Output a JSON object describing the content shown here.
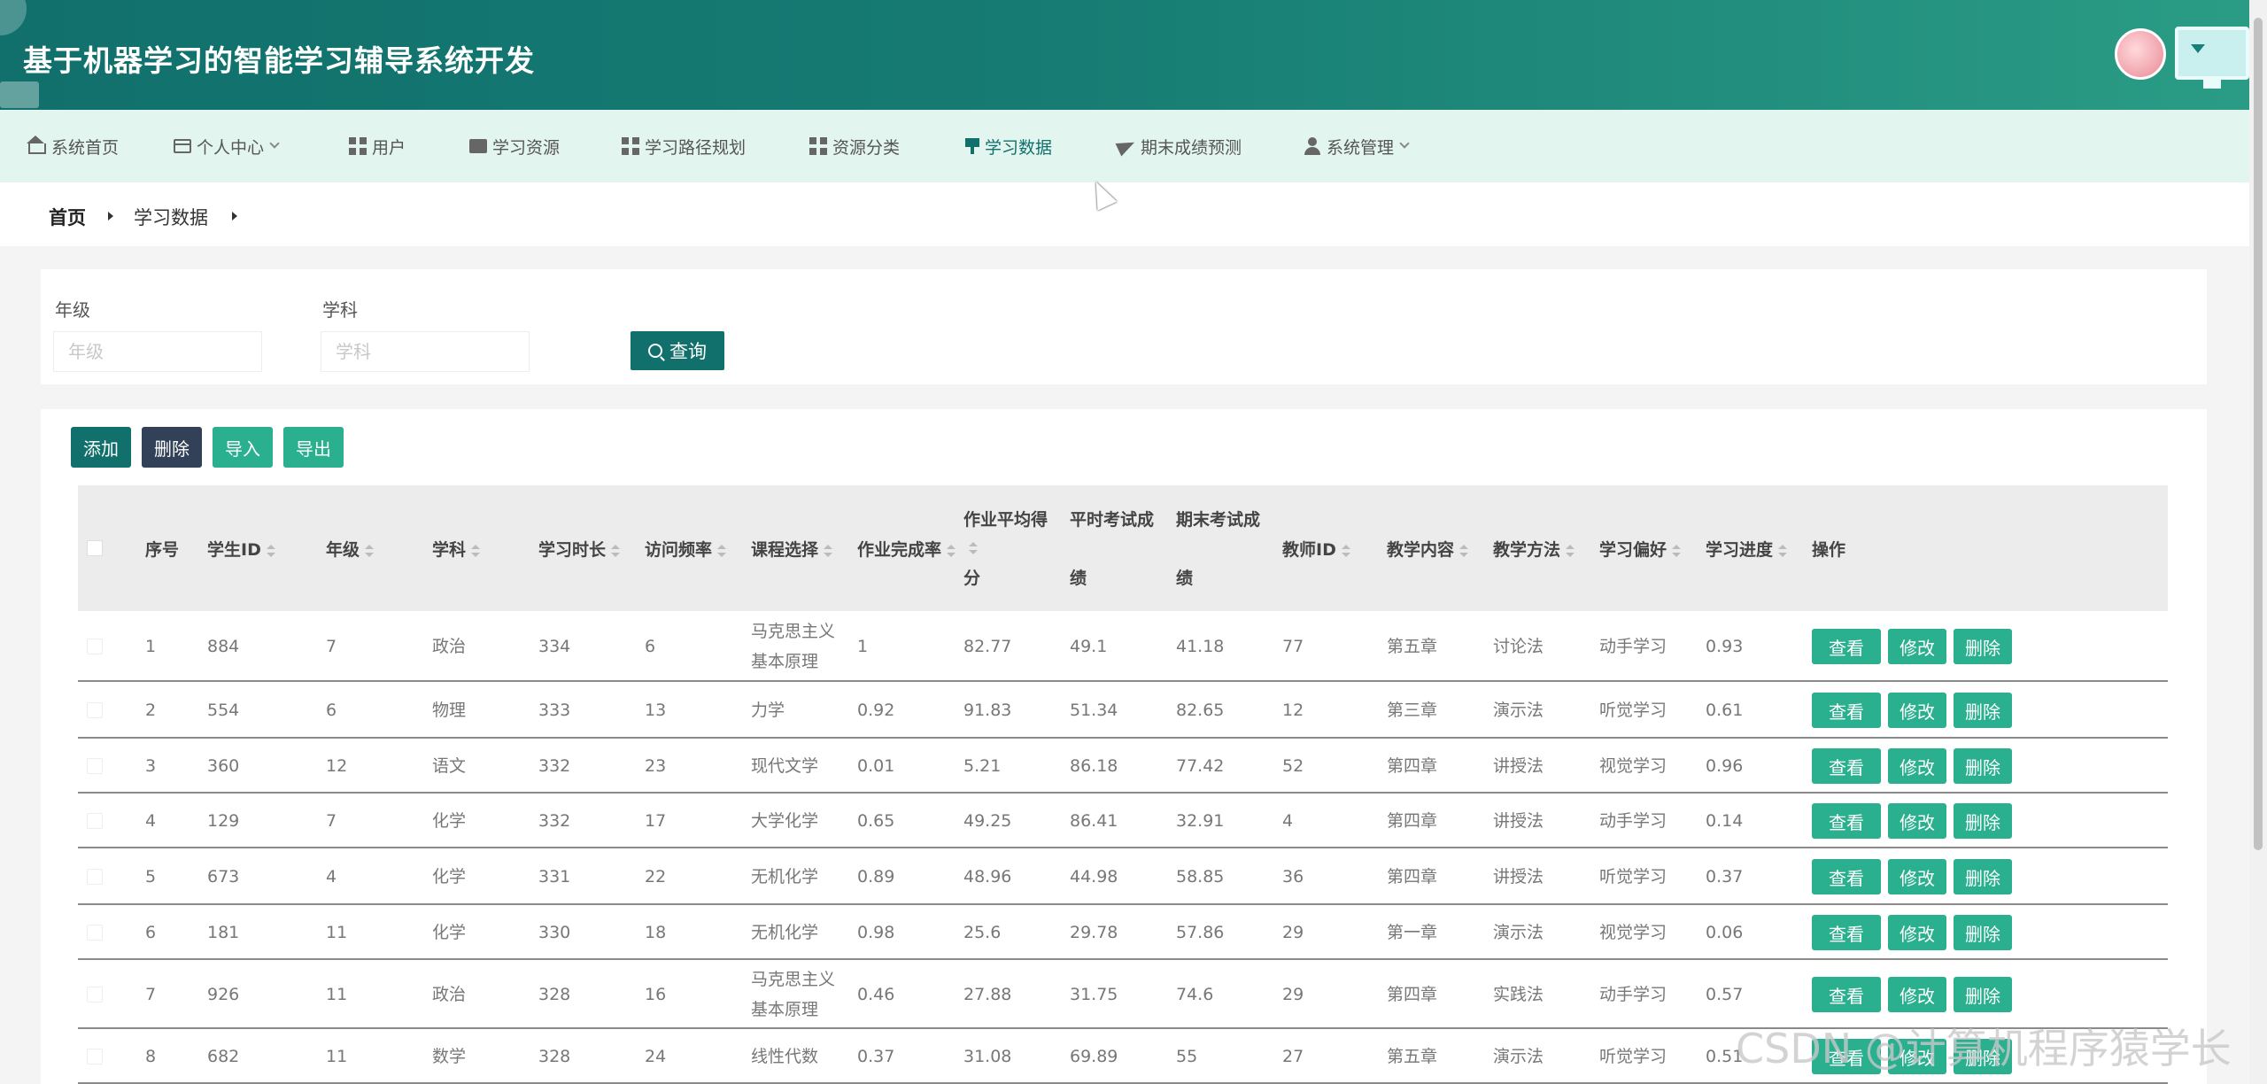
{
  "header": {
    "title": "基于机器学习的智能学习辅导系统开发"
  },
  "nav": [
    {
      "label": "系统首页",
      "icon": "home-icon"
    },
    {
      "label": "个人中心",
      "icon": "card-icon",
      "dropdown": true
    },
    {
      "label": "用户",
      "icon": "grid-icon"
    },
    {
      "label": "学习资源",
      "icon": "book-icon"
    },
    {
      "label": "学习路径规划",
      "icon": "grid-icon"
    },
    {
      "label": "资源分类",
      "icon": "grid-icon"
    },
    {
      "label": "学习数据",
      "icon": "pin-icon",
      "active": true
    },
    {
      "label": "期末成绩预测",
      "icon": "plane-icon"
    },
    {
      "label": "系统管理",
      "icon": "user-icon",
      "dropdown": true
    }
  ],
  "breadcrumb": {
    "home": "首页",
    "current": "学习数据"
  },
  "search": {
    "grade_label": "年级",
    "grade_placeholder": "年级",
    "subject_label": "学科",
    "subject_placeholder": "学科",
    "query_button": "查询"
  },
  "toolbar": {
    "add": "添加",
    "delete": "删除",
    "import": "导入",
    "export": "导出"
  },
  "table": {
    "headers": {
      "index": "序号",
      "student_id": "学生ID",
      "grade": "年级",
      "subject": "学科",
      "study_time": "学习时长",
      "visit_freq": "访问频率",
      "course": "课程选择",
      "hw_rate": "作业完成率",
      "hw_avg_1": "作业平均得",
      "hw_avg_2": "分",
      "mid_1": "平时考试成",
      "mid_2": "绩",
      "final_1": "期末考试成",
      "final_2": "绩",
      "teacher_id": "教师ID",
      "content": "教学内容",
      "method": "教学方法",
      "preference": "学习偏好",
      "progress": "学习进度",
      "ops": "操作"
    },
    "action_labels": {
      "view": "查看",
      "edit": "修改",
      "delete": "删除"
    },
    "rows": [
      {
        "index": "1",
        "student_id": "884",
        "grade": "7",
        "subject": "政治",
        "study_time": "334",
        "visit_freq": "6",
        "course": [
          "马克思主义",
          "基本原理"
        ],
        "hw_rate": "1",
        "hw_avg": "82.77",
        "mid": "49.1",
        "final": "41.18",
        "teacher_id": "77",
        "content": "第五章",
        "method": "讨论法",
        "preference": "动手学习",
        "progress": "0.93"
      },
      {
        "index": "2",
        "student_id": "554",
        "grade": "6",
        "subject": "物理",
        "study_time": "333",
        "visit_freq": "13",
        "course": [
          "力学"
        ],
        "hw_rate": "0.92",
        "hw_avg": "91.83",
        "mid": "51.34",
        "final": "82.65",
        "teacher_id": "12",
        "content": "第三章",
        "method": "演示法",
        "preference": "听觉学习",
        "progress": "0.61"
      },
      {
        "index": "3",
        "student_id": "360",
        "grade": "12",
        "subject": "语文",
        "study_time": "332",
        "visit_freq": "23",
        "course": [
          "现代文学"
        ],
        "hw_rate": "0.01",
        "hw_avg": "5.21",
        "mid": "86.18",
        "final": "77.42",
        "teacher_id": "52",
        "content": "第四章",
        "method": "讲授法",
        "preference": "视觉学习",
        "progress": "0.96"
      },
      {
        "index": "4",
        "student_id": "129",
        "grade": "7",
        "subject": "化学",
        "study_time": "332",
        "visit_freq": "17",
        "course": [
          "大学化学"
        ],
        "hw_rate": "0.65",
        "hw_avg": "49.25",
        "mid": "86.41",
        "final": "32.91",
        "teacher_id": "4",
        "content": "第四章",
        "method": "讲授法",
        "preference": "动手学习",
        "progress": "0.14"
      },
      {
        "index": "5",
        "student_id": "673",
        "grade": "4",
        "subject": "化学",
        "study_time": "331",
        "visit_freq": "22",
        "course": [
          "无机化学"
        ],
        "hw_rate": "0.89",
        "hw_avg": "48.96",
        "mid": "44.98",
        "final": "58.85",
        "teacher_id": "36",
        "content": "第四章",
        "method": "讲授法",
        "preference": "听觉学习",
        "progress": "0.37"
      },
      {
        "index": "6",
        "student_id": "181",
        "grade": "11",
        "subject": "化学",
        "study_time": "330",
        "visit_freq": "18",
        "course": [
          "无机化学"
        ],
        "hw_rate": "0.98",
        "hw_avg": "25.6",
        "mid": "29.78",
        "final": "57.86",
        "teacher_id": "29",
        "content": "第一章",
        "method": "演示法",
        "preference": "视觉学习",
        "progress": "0.06"
      },
      {
        "index": "7",
        "student_id": "926",
        "grade": "11",
        "subject": "政治",
        "study_time": "328",
        "visit_freq": "16",
        "course": [
          "马克思主义",
          "基本原理"
        ],
        "hw_rate": "0.46",
        "hw_avg": "27.88",
        "mid": "31.75",
        "final": "74.6",
        "teacher_id": "29",
        "content": "第四章",
        "method": "实践法",
        "preference": "动手学习",
        "progress": "0.57"
      },
      {
        "index": "8",
        "student_id": "682",
        "grade": "11",
        "subject": "数学",
        "study_time": "328",
        "visit_freq": "24",
        "course": [
          "线性代数"
        ],
        "hw_rate": "0.37",
        "hw_avg": "31.08",
        "mid": "69.89",
        "final": "55",
        "teacher_id": "27",
        "content": "第五章",
        "method": "演示法",
        "preference": "听觉学习",
        "progress": "0.51"
      }
    ]
  },
  "watermark": "CSDN @计算机程序猿学长",
  "colors": {
    "primary": "#11706c",
    "accent": "#2bb08f",
    "dark": "#324157"
  }
}
